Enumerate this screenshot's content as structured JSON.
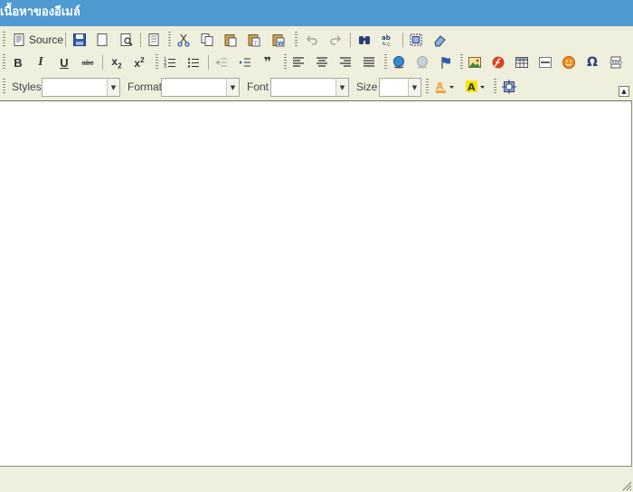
{
  "title": "เนื้อหาของอีเมล์",
  "toolbar": {
    "source_label": "Source",
    "styles_label": "Styles",
    "format_label": "Format",
    "font_label": "Font",
    "size_label": "Size",
    "styles_value": "",
    "format_value": "",
    "font_value": "",
    "size_value": "",
    "bold_glyph": "B",
    "italic_glyph": "I",
    "underline_glyph": "U",
    "strike_glyph": "abc",
    "subscript_glyph": "x",
    "subscript_mark": "2",
    "superscript_glyph": "x",
    "superscript_mark": "2",
    "blockquote_glyph": "❞",
    "omega_glyph": "Ω"
  },
  "colors": {
    "title_bar": "#4f9ad1",
    "toolbar_bg": "#efefde",
    "save_blue": "#2b5fa8",
    "link_green": "#3a8a3a",
    "flash_red": "#d9431f",
    "smiley_orange": "#f28c1e",
    "text_color_orange": "#f2a23a",
    "highlight_yellow": "#f6e600"
  }
}
